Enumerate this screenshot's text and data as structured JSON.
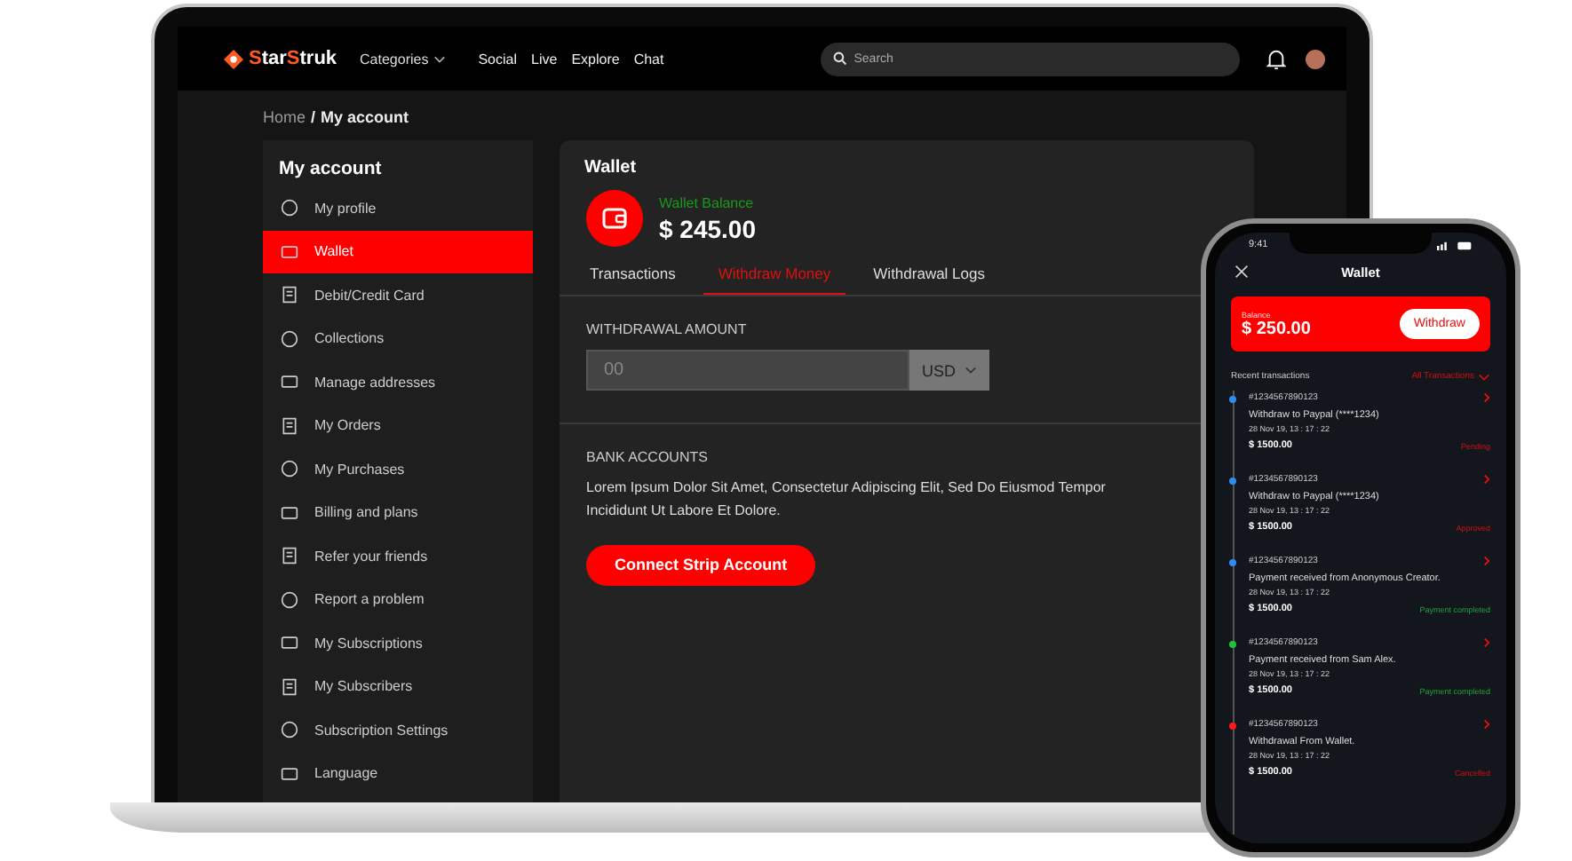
{
  "nav": {
    "logo_first": "Star",
    "logo_second": "Struk",
    "categories": "Categories",
    "links": [
      "Social",
      "Live",
      "Explore",
      "Chat"
    ],
    "search_placeholder": "Search"
  },
  "breadcrumb": {
    "parent": "Home",
    "separator": "/",
    "current": "My account"
  },
  "sidebar": {
    "title": "My account",
    "items": [
      {
        "label": "My profile",
        "selected": false
      },
      {
        "label": "Wallet",
        "selected": true
      },
      {
        "label": "Debit/Credit Card",
        "selected": false
      },
      {
        "label": "Collections",
        "selected": false
      },
      {
        "label": "Manage addresses",
        "selected": false
      },
      {
        "label": "My Orders",
        "selected": false
      },
      {
        "label": "My Purchases",
        "selected": false
      },
      {
        "label": "Billing and plans",
        "selected": false
      },
      {
        "label": "Refer your friends",
        "selected": false
      },
      {
        "label": "Report a problem",
        "selected": false
      },
      {
        "label": "My Subscriptions",
        "selected": false
      },
      {
        "label": "My Subscribers",
        "selected": false
      },
      {
        "label": "Subscription Settings",
        "selected": false
      },
      {
        "label": "Language",
        "selected": false
      }
    ]
  },
  "wallet": {
    "title": "Wallet",
    "balance_label": "Wallet Balance",
    "balance": "$ 245.00",
    "tabs": [
      {
        "label": "Transactions",
        "selected": false
      },
      {
        "label": "Withdraw Money",
        "selected": true
      },
      {
        "label": "Withdrawal Logs",
        "selected": false
      }
    ],
    "amount_label": "WITHDRAWAL AMOUNT",
    "amount_placeholder": "00",
    "currency": "USD",
    "bank_title": "BANK ACCOUNTS",
    "bank_text": "Lorem Ipsum Dolor Sit Amet, Consectetur Adipiscing Elit, Sed Do Eiusmod Tempor Incididunt Ut Labore Et Dolore.",
    "connect_button": "Connect Strip Account"
  },
  "phone": {
    "time": "9:41",
    "title": "Wallet",
    "balance_label": "Balance",
    "balance": "$ 250.00",
    "withdraw_button": "Withdraw",
    "recent_label": "Recent transactions",
    "filter": "All Transactions",
    "transactions": [
      {
        "id": "#1234567890123",
        "description": "Withdraw to Paypal (****1234)",
        "date": "28 Nov 19, 13 : 17 : 22",
        "amount": "$ 1500.00",
        "status": "Pending",
        "kind": "negative",
        "color": "#2f8cf0"
      },
      {
        "id": "#1234567890123",
        "description": "Withdraw to Paypal (****1234)",
        "date": "28 Nov 19, 13 : 17 : 22",
        "amount": "$ 1500.00",
        "status": "Approved",
        "kind": "negative",
        "color": "#2f8cf0"
      },
      {
        "id": "#1234567890123",
        "description": "Payment received from Anonymous Creator.",
        "date": "28 Nov 19, 13 : 17 : 22",
        "amount": "$ 1500.00",
        "status": "Payment completed",
        "kind": "positive",
        "color": "#2f8cf0"
      },
      {
        "id": "#1234567890123",
        "description": "Payment received from Sam Alex.",
        "date": "28 Nov 19, 13 : 17 : 22",
        "amount": "$ 1500.00",
        "status": "Payment completed",
        "kind": "positive",
        "color": "#1fc43a"
      },
      {
        "id": "#1234567890123",
        "description": "Withdrawal From Wallet.",
        "date": "28 Nov 19, 13 : 17 : 22",
        "amount": "$ 1500.00",
        "status": "Cancelled",
        "kind": "negative",
        "color": "#ff1a1a"
      }
    ]
  }
}
